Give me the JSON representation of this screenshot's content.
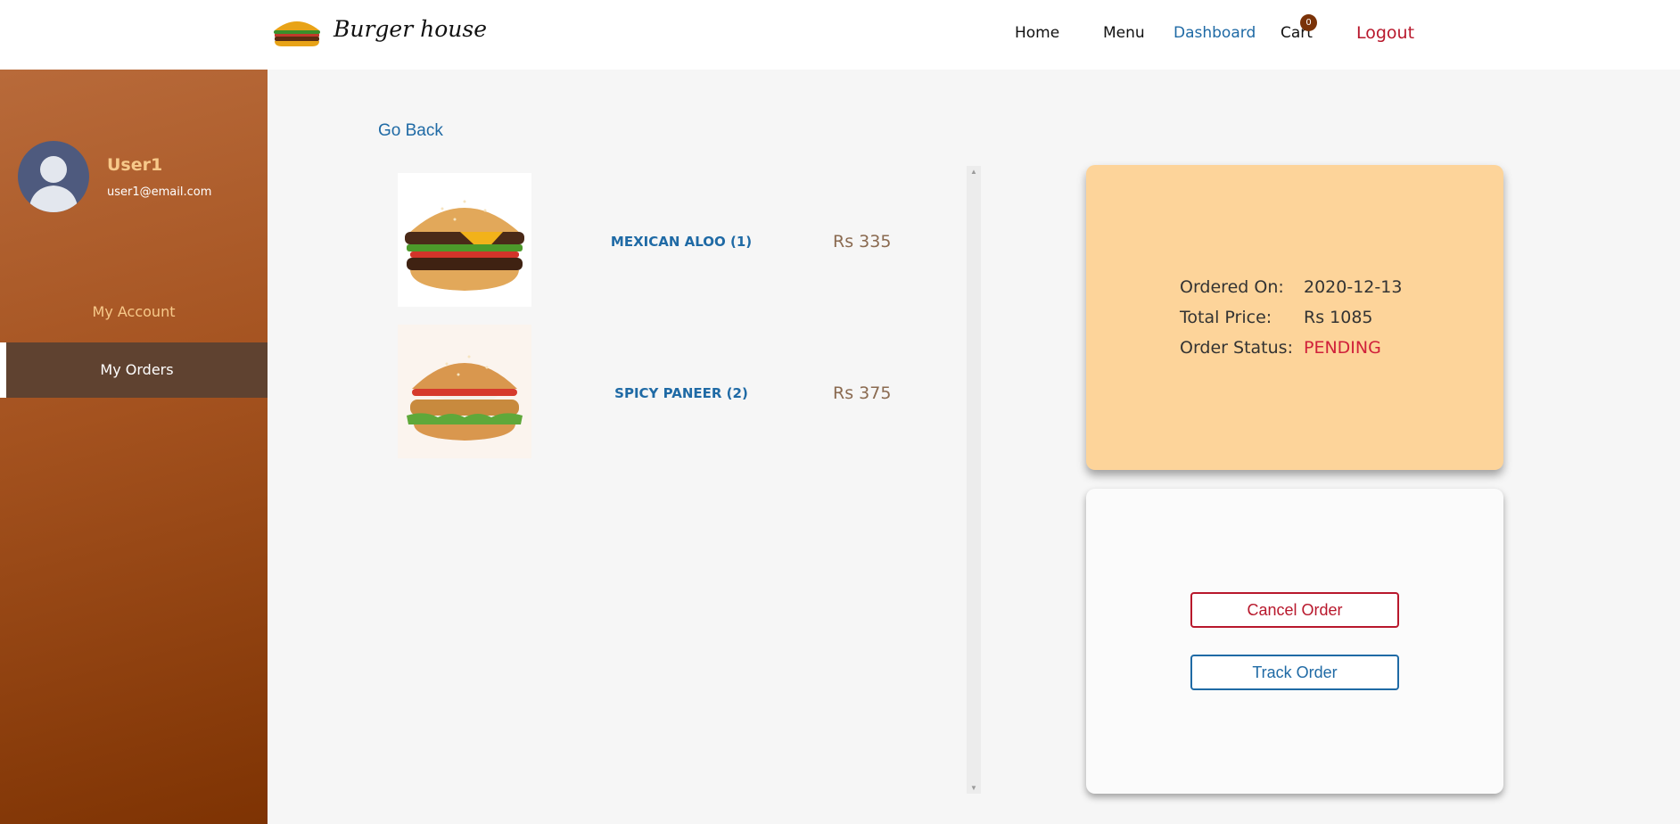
{
  "brand": {
    "name": "Burger house",
    "logo_icon": "burger-icon"
  },
  "nav": {
    "home": "Home",
    "menu": "Menu",
    "dashboard": "Dashboard",
    "cart": "Cart",
    "cart_count": "0",
    "logout": "Logout",
    "active": "Dashboard"
  },
  "sidebar": {
    "user_name": "User1",
    "user_email": "user1@email.com",
    "items": [
      {
        "label": "My Account"
      },
      {
        "label": "My Orders",
        "active": true
      }
    ]
  },
  "main": {
    "go_back": "Go Back",
    "items": [
      {
        "name": "MEXICAN ALOO (1)",
        "price": "Rs 335",
        "image": "cheeseburger-image"
      },
      {
        "name": "SPICY PANEER (2)",
        "price": "Rs 375",
        "image": "chicken-burger-image"
      }
    ],
    "order": {
      "ordered_on_label": "Ordered On:",
      "ordered_on": "2020-12-13",
      "total_label": "Total Price:",
      "total": "Rs 1085",
      "status_label": "Order Status:",
      "status": "PENDING"
    },
    "actions": {
      "cancel": "Cancel Order",
      "track": "Track Order"
    }
  },
  "colors": {
    "accent_blue": "#1f6aa5",
    "danger_red": "#b8182c",
    "card_orange": "#fdd49a",
    "sidebar_brown": "#a4521f"
  }
}
